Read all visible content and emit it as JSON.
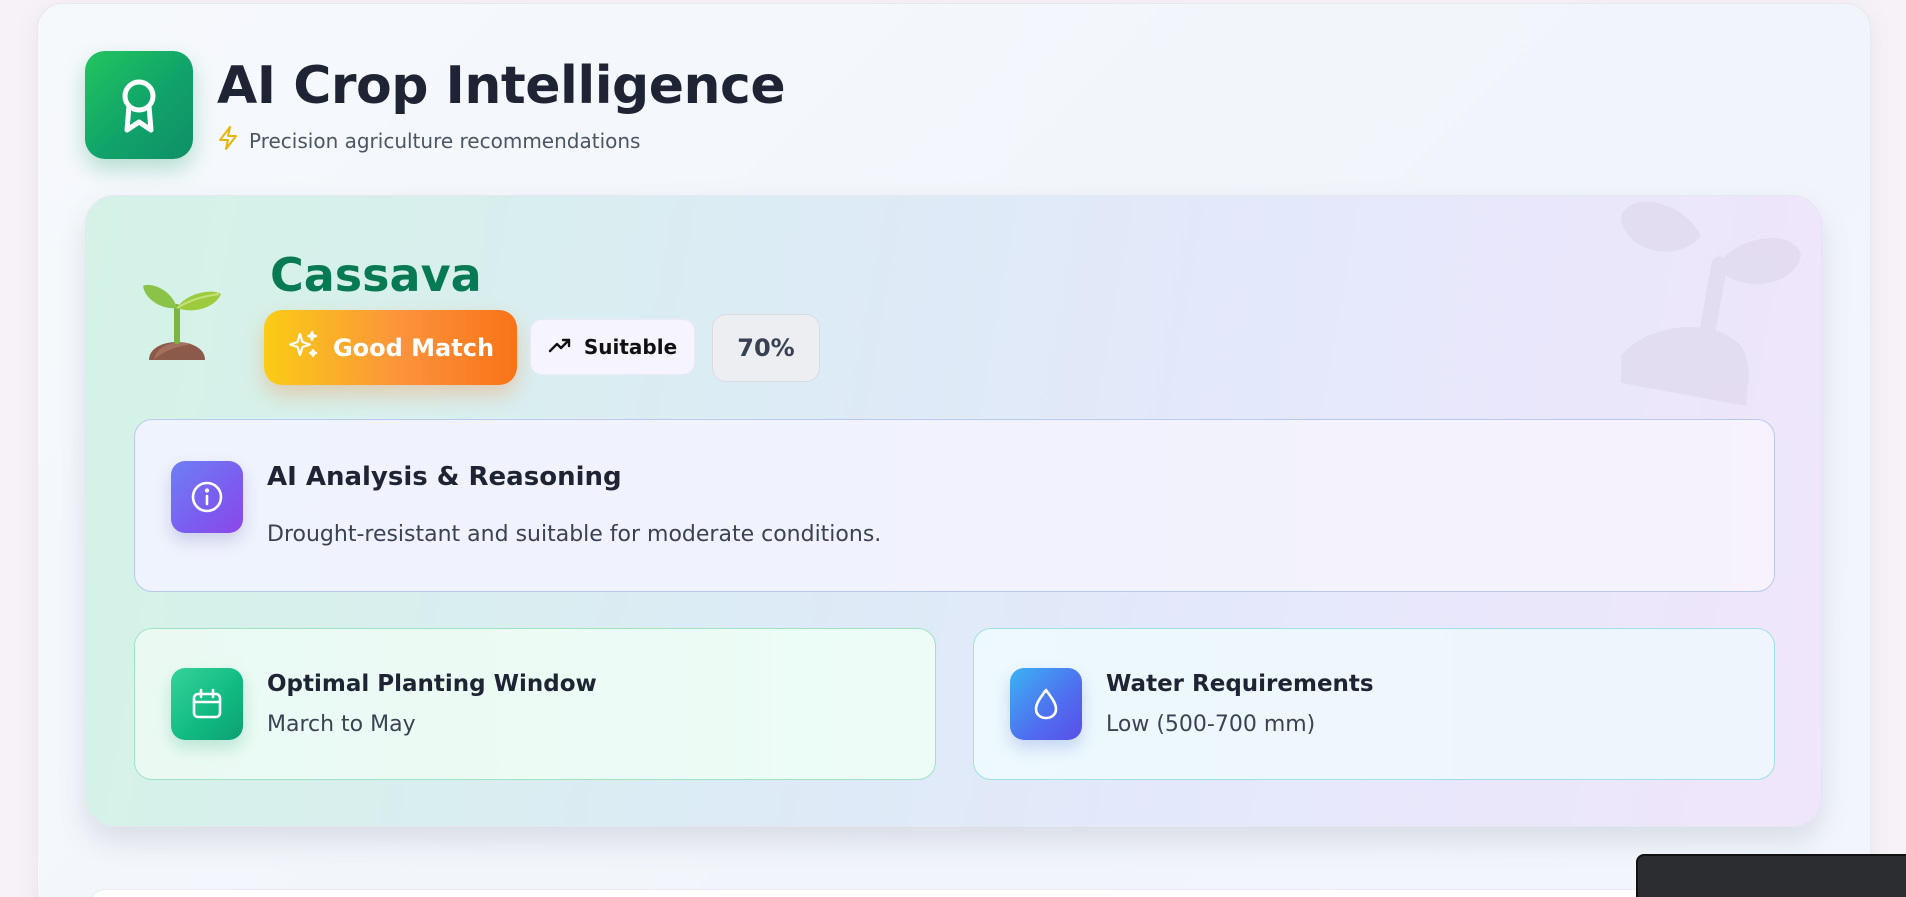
{
  "header": {
    "title": "AI Crop Intelligence",
    "subtitle": "Precision agriculture recommendations",
    "logo_icon": "award-ribbon-icon",
    "subtitle_icon": "lightning-bolt-icon"
  },
  "recommendation": {
    "crop_name": "Cassava",
    "crop_icon": "seedling-emoji",
    "match_label": "Good Match",
    "match_icon": "sparkles-icon",
    "suitability_label": "Suitable",
    "suitability_icon": "trending-up-icon",
    "score": "70%",
    "analysis": {
      "title": "AI Analysis & Reasoning",
      "text": "Drought-resistant and suitable for moderate conditions.",
      "icon": "info-icon"
    },
    "planting": {
      "title": "Optimal Planting Window",
      "value": "March to May",
      "icon": "calendar-icon"
    },
    "water": {
      "title": "Water Requirements",
      "value": "Low (500-700 mm)",
      "icon": "water-drop-icon"
    }
  },
  "colors": {
    "brand_green": "#10a36a",
    "crop_name": "#087a53",
    "match_gradient_start": "#facc15",
    "match_gradient_end": "#f97316",
    "analysis_icon": "#7c5cf0",
    "planting_icon": "#10b981",
    "water_icon": "#4f6df0"
  }
}
